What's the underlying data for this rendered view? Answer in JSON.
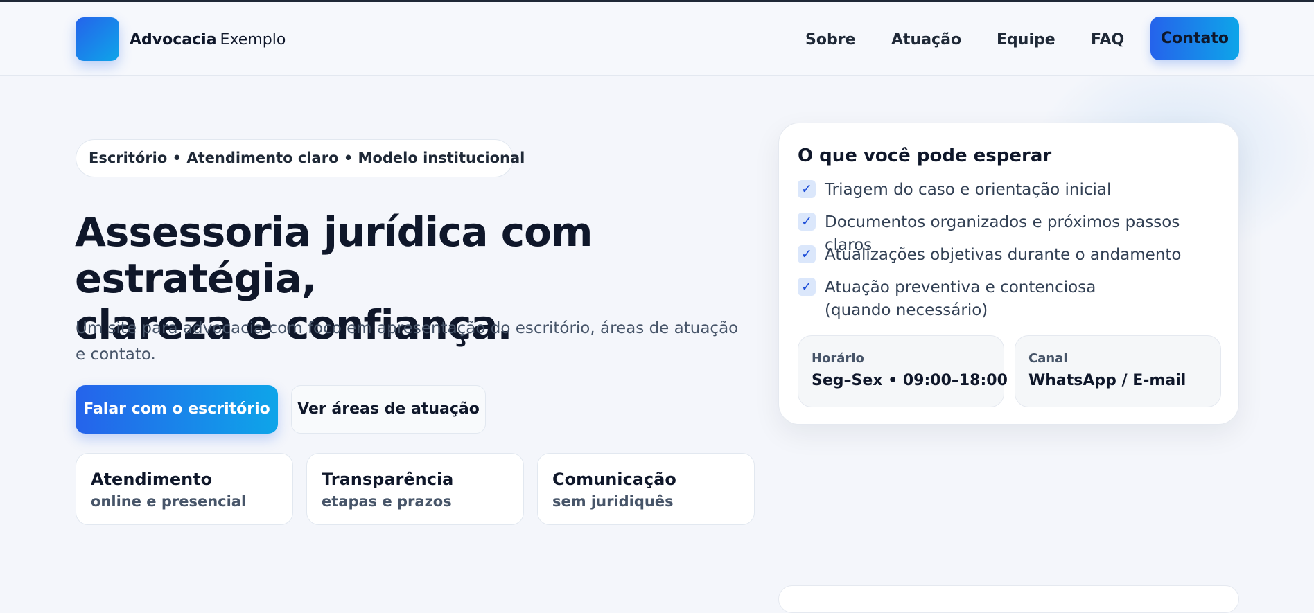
{
  "header": {
    "brand_bold": "Advocacia",
    "brand_light": "Exemplo",
    "nav": [
      "Sobre",
      "Atuação",
      "Equipe",
      "FAQ"
    ],
    "contact_label": "Contato"
  },
  "hero": {
    "pill": "Escritório • Atendimento claro • Modelo institucional",
    "title_line1": "Assessoria jurídica com estratégia,",
    "title_line2": "clareza e confiança.",
    "lead": "Um site para advocacia com foco em apresentação do escritório, áreas de atuação e contato.",
    "primary_cta": "Falar com o escritório",
    "secondary_cta": "Ver áreas de atuação",
    "features": [
      {
        "title": "Atendimento",
        "subtitle": "online e presencial"
      },
      {
        "title": "Transparência",
        "subtitle": "etapas e prazos"
      },
      {
        "title": "Comunicação",
        "subtitle": "sem juridiquês"
      }
    ]
  },
  "expect_card": {
    "title": "O que você pode esperar",
    "check_glyph": "✓",
    "items": [
      "Triagem do caso e orientação inicial",
      "Documentos organizados e próximos passos claros",
      "Atualizações objetivas durante o andamento",
      "Atuação preventiva e contenciosa (quando necessário)"
    ],
    "schedule_label": "Horário",
    "schedule_value": "Seg–Sex • 09:00–18:00",
    "channel_label": "Canal",
    "channel_value": "WhatsApp / E-mail"
  },
  "colors": {
    "accent_start": "#2563eb",
    "accent_end": "#0ea5e9",
    "background": "#f4f6fb",
    "text_dark": "#0f172a",
    "text_muted": "#475569"
  }
}
